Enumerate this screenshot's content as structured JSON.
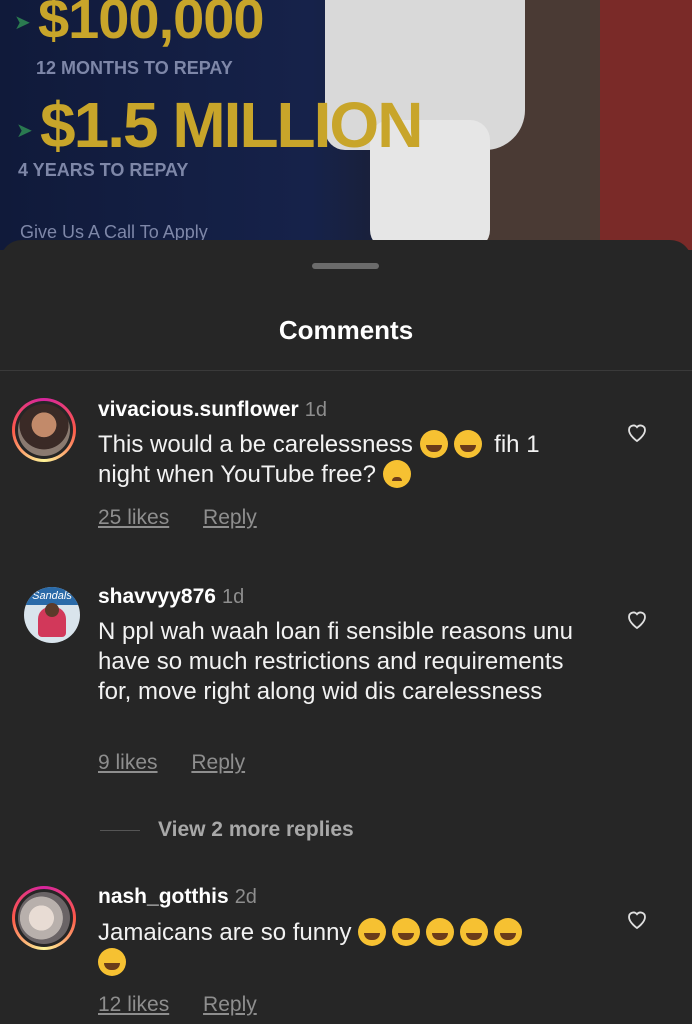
{
  "background_ad": {
    "line1": "$100,000",
    "line2": "12 MONTHS TO REPAY",
    "line3": "$1.5 MILLION",
    "line4": "4 YEARS TO REPAY",
    "line5": "Give Us A Call To Apply"
  },
  "sheet": {
    "title": "Comments"
  },
  "comments": [
    {
      "username": "vivacious.sunflower",
      "time": "1d",
      "text_part1": "This would a be carelessness",
      "text_part2": "fih 1",
      "text_part3": "night when YouTube free?",
      "likes": "25 likes",
      "reply": "Reply"
    },
    {
      "username": "shavvyy876",
      "time": "1d",
      "text": "N ppl wah waah loan fi sensible reasons unu have so much restrictions and requirements for, move right along wid dis carelessness",
      "likes": "9 likes",
      "reply": "Reply",
      "view_more": "View 2 more replies"
    },
    {
      "username": "nash_gotthis",
      "time": "2d",
      "text": "Jamaicans are so funny",
      "likes": "12 likes",
      "reply": "Reply"
    }
  ],
  "avatar_caption": "Sandals",
  "icons": {
    "like": "heart-outline-icon",
    "emoji_laugh": "face-with-tears-of-joy-emoji",
    "emoji_cry": "loudly-crying-face-emoji",
    "emoji_rofl": "rolling-on-floor-laughing-emoji",
    "emoji_sad": "crying-face-emoji"
  },
  "colors": {
    "sheet_bg": "#262626",
    "text_primary": "#ffffff",
    "text_secondary": "#8e8e8e"
  }
}
